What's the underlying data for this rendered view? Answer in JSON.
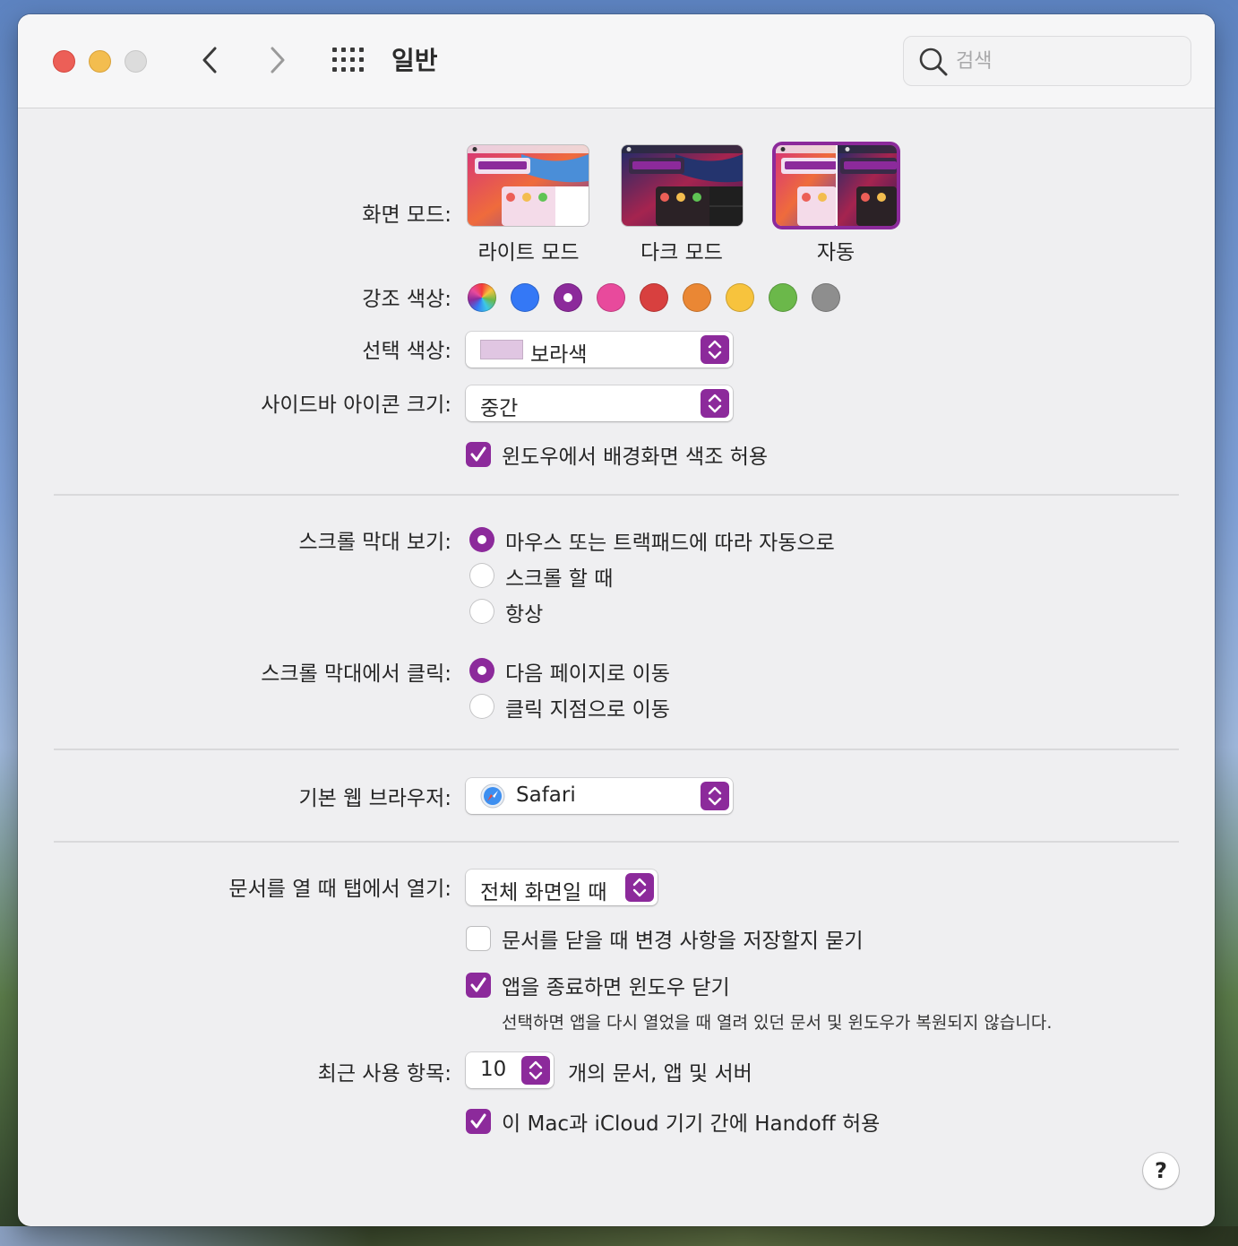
{
  "window": {
    "title": "일반"
  },
  "search": {
    "placeholder": "검색"
  },
  "appearance": {
    "label": "화면 모드:",
    "options": [
      {
        "label": "라이트 모드",
        "selected": false
      },
      {
        "label": "다크 모드",
        "selected": false
      },
      {
        "label": "자동",
        "selected": true
      }
    ]
  },
  "accent": {
    "label": "강조 색상:",
    "colors": [
      "multicolor",
      "#3478f6",
      "#8c2a9b",
      "#e84a9c",
      "#d8403f",
      "#ea8734",
      "#f7c33d",
      "#6bb84a",
      "#8e8e8e"
    ],
    "selected": "#8c2a9b"
  },
  "highlight": {
    "label": "선택 색상:",
    "value": "보라색",
    "swatch_color": "#e0c6e2"
  },
  "sidebar_icon": {
    "label": "사이드바 아이콘 크기:",
    "value": "중간"
  },
  "tinting": {
    "label": "윈도우에서 배경화면 색조 허용",
    "checked": true
  },
  "scrollbars": {
    "label": "스크롤 막대 보기:",
    "options": [
      {
        "label": "마우스 또는 트랙패드에 따라 자동으로",
        "selected": true
      },
      {
        "label": "스크롤 할 때",
        "selected": false
      },
      {
        "label": "항상",
        "selected": false
      }
    ]
  },
  "scroll_click": {
    "label": "스크롤 막대에서 클릭:",
    "options": [
      {
        "label": "다음 페이지로 이동",
        "selected": true
      },
      {
        "label": "클릭 지점으로 이동",
        "selected": false
      }
    ]
  },
  "browser": {
    "label": "기본 웹 브라우저:",
    "value": "Safari"
  },
  "tabs": {
    "label": "문서를 열 때 탭에서 열기:",
    "value": "전체 화면일 때"
  },
  "ask_save": {
    "label": "문서를 닫을 때 변경 사항을 저장할지 묻기",
    "checked": false
  },
  "close_windows": {
    "label": "앱을 종료하면 윈도우 닫기",
    "checked": true,
    "note": "선택하면 앱을 다시 열었을 때 열려 있던 문서 및 윈도우가 복원되지 않습니다."
  },
  "recent": {
    "label": "최근 사용 항목:",
    "value": "10",
    "suffix": "개의 문서, 앱 및 서버"
  },
  "handoff": {
    "label": "이 Mac과 iCloud 기기 간에 Handoff 허용",
    "checked": true
  },
  "help": {
    "label": "?"
  }
}
